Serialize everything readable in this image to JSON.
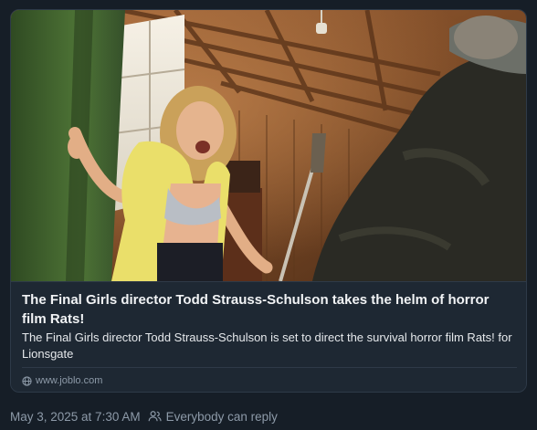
{
  "link_card": {
    "image_icon": "movie-still-image",
    "title": "The Final Girls director Todd Strauss-Schulson takes the helm of horror film Rats!",
    "description": "The Final Girls director Todd Strauss-Schulson is set to direct the survival horror film Rats! for Lionsgate",
    "domain_icon": "globe-icon",
    "domain": "www.joblo.com"
  },
  "post_meta": {
    "timestamp": "May 3, 2025 at 7:30 AM",
    "reply_icon": "people-icon",
    "reply_setting": "Everybody can reply"
  },
  "colors": {
    "background": "#161e27",
    "card": "#1e2833",
    "border": "#2e3a48",
    "muted_text": "#8d9aa8",
    "primary_text": "#f1f3f5"
  }
}
